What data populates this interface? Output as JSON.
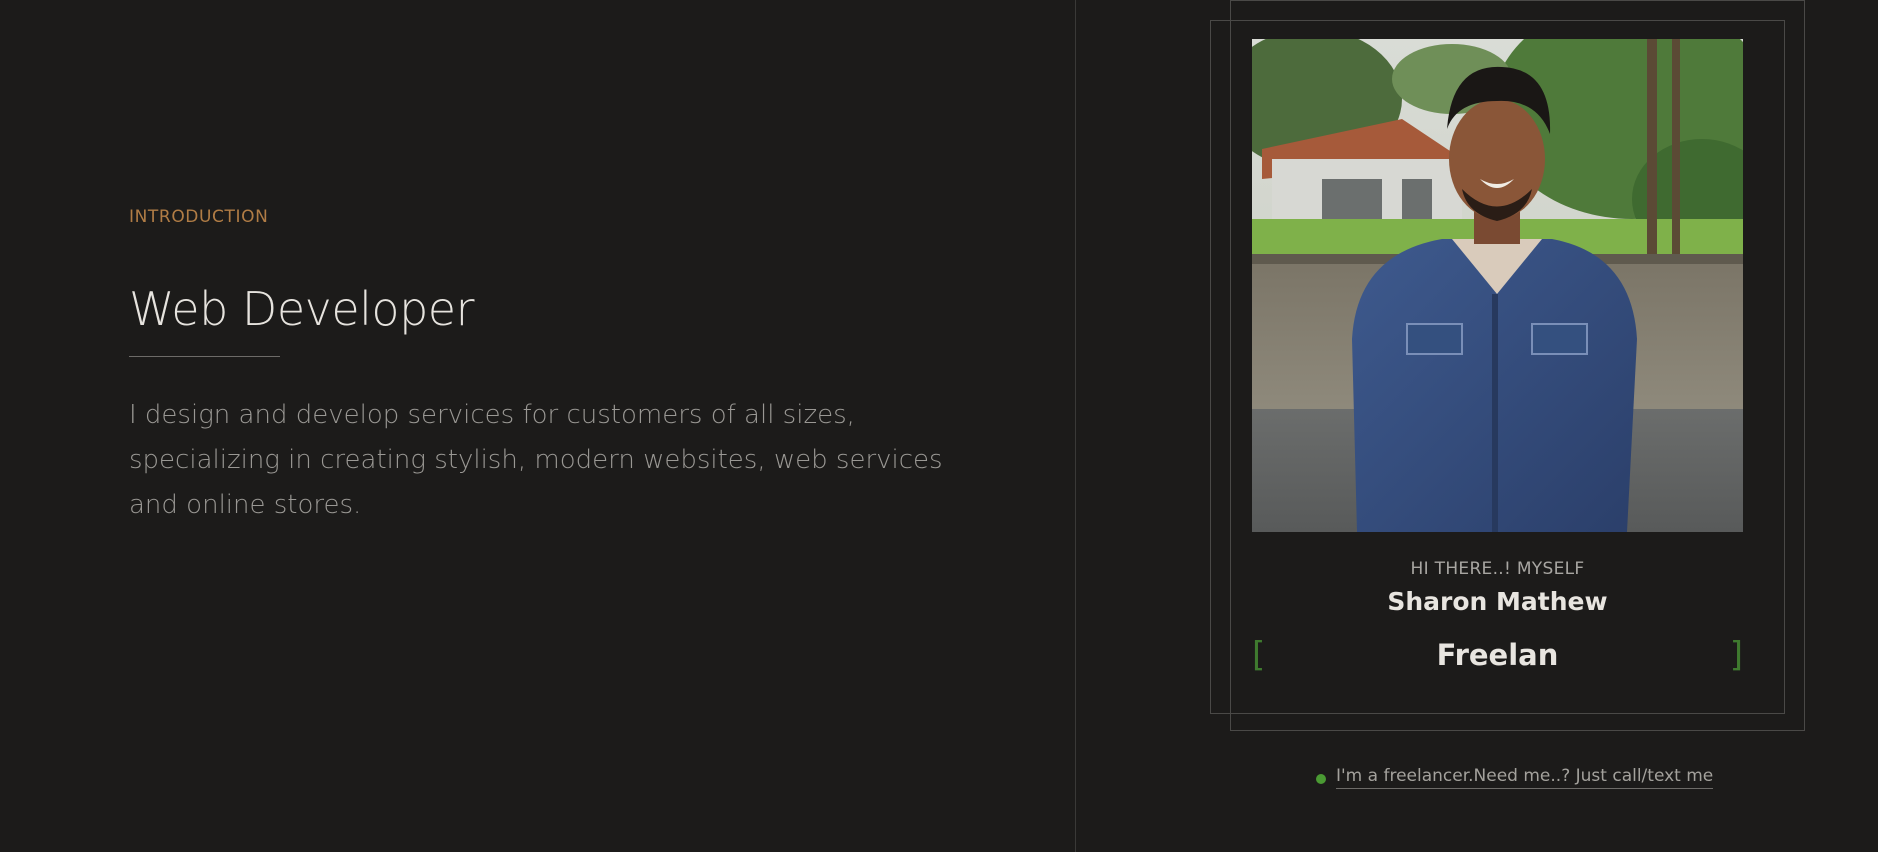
{
  "intro": {
    "eyebrow": "INTRODUCTION",
    "headline": "Web Developer",
    "description": "I design and develop services for customers of all sizes, specializing in creating stylish, modern websites, web services and online stores."
  },
  "profile": {
    "greeting": "HI THERE..! MYSELF",
    "name": "Sharon Mathew",
    "role": "Freelan",
    "bracket_open": "[",
    "bracket_close": "]"
  },
  "status": {
    "text": "I'm a freelancer.Need me..? Just call/text me",
    "dot_color": "#4a9a33"
  },
  "colors": {
    "background": "#1c1b1a",
    "accent": "#b07c45",
    "bracket": "#3f7a2f"
  }
}
